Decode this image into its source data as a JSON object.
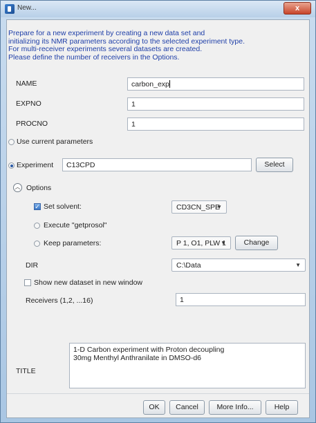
{
  "window": {
    "title": "New...",
    "close_label": "x"
  },
  "intro": [
    "Prepare for a new experiment by creating a new data set and",
    "initializing its NMR parameters according to the selected experiment type.",
    "For multi-receiver experiments several datasets are created.",
    "Please define the number of receivers in the Options."
  ],
  "fields": {
    "name_label": "NAME",
    "name_value": "carbon_exp",
    "expno_label": "EXPNO",
    "expno_value": "1",
    "procno_label": "PROCNO",
    "procno_value": "1"
  },
  "mode": {
    "use_current_label": "Use current parameters",
    "use_current_selected": false,
    "experiment_label": "Experiment",
    "experiment_selected": true,
    "experiment_value": "C13CPD",
    "select_button": "Select"
  },
  "options": {
    "toggle_label": "Options",
    "toggle_icon": "chevron-up-icon",
    "set_solvent_label": "Set solvent:",
    "set_solvent_checked": true,
    "solvent_value": "CD3CN_SPE",
    "execute_label": "Execute \"getprosol\"",
    "keep_label": "Keep parameters:",
    "keep_value": "P 1, O1, PLW 1",
    "change_button": "Change",
    "dir_label": "DIR",
    "dir_value": "C:\\Data",
    "show_new_label": "Show new dataset in new window",
    "show_new_checked": false,
    "receivers_label": "Receivers (1,2, ...16)",
    "receivers_value": "1"
  },
  "title_section": {
    "label": "TITLE",
    "line1": "1-D Carbon experiment with Proton decoupling",
    "line2": "30mg Menthyl Anthranilate in DMSO-d6"
  },
  "buttons": {
    "ok": "OK",
    "cancel": "Cancel",
    "more_info": "More Info...",
    "help": "Help"
  },
  "colors": {
    "intro_text": "#1f3fa8",
    "title_bar": "#b8d0e8",
    "close_button": "#c8452b"
  }
}
